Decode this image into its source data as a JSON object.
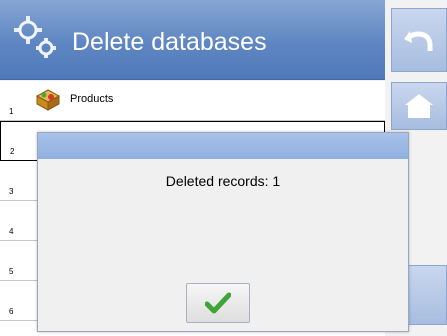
{
  "header": {
    "title": "Delete databases",
    "icon": "gears-icon"
  },
  "side_buttons": [
    {
      "name": "back-button",
      "icon": "undo-arrow-icon"
    },
    {
      "name": "home-button",
      "icon": "home-icon"
    }
  ],
  "list": {
    "rows": [
      {
        "number": "1",
        "label": "Products",
        "icon": "products-box-icon"
      },
      {
        "number": "2",
        "label": "",
        "icon": "database-icon"
      },
      {
        "number": "3",
        "label": ""
      },
      {
        "number": "4",
        "label": ""
      },
      {
        "number": "5",
        "label": ""
      },
      {
        "number": "6",
        "label": ""
      }
    ]
  },
  "dialog": {
    "message": "Deleted records: 1",
    "ok_icon": "checkmark-icon"
  },
  "colors": {
    "header": "#5e86c2",
    "side_button": "#b7c9e6",
    "checkmark": "#3fa536"
  }
}
